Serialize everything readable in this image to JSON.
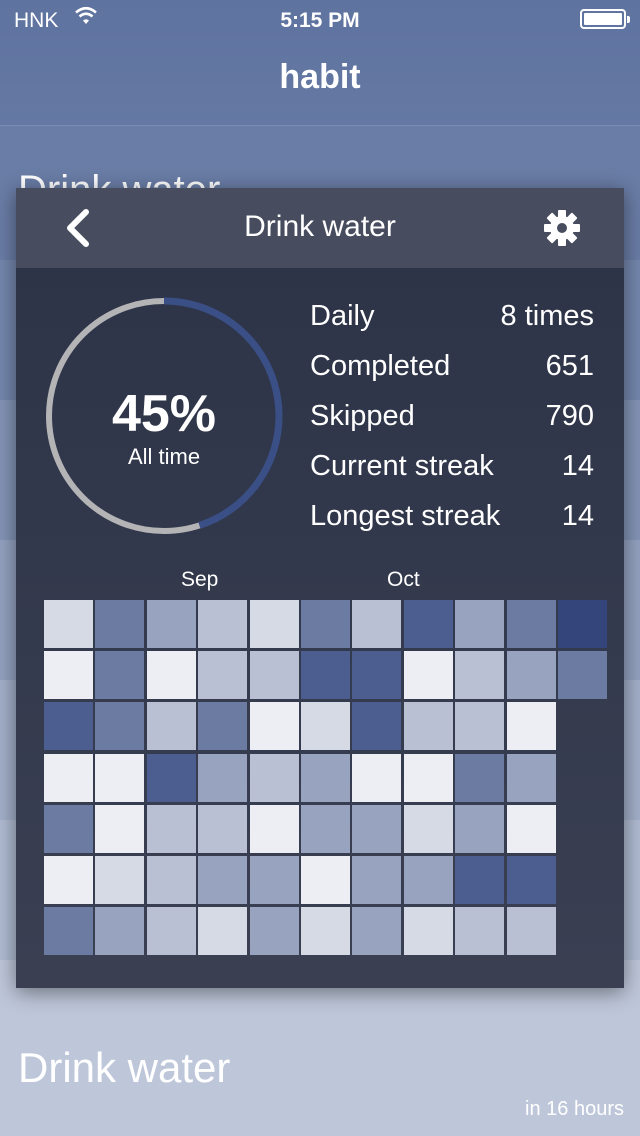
{
  "status_bar": {
    "carrier": "HNK",
    "time": "5:15 PM"
  },
  "app": {
    "title": "habit",
    "background_item_top": "Drink water",
    "background_item_bottom": "Drink water",
    "background_item_bottom_sub": "in 16 hours"
  },
  "card": {
    "title": "Drink water",
    "progress_percent": 45,
    "progress_label": "45%",
    "progress_sub": "All time",
    "stats": [
      {
        "label": "Daily",
        "value": "8 times"
      },
      {
        "label": "Completed",
        "value": "651"
      },
      {
        "label": "Skipped",
        "value": "790"
      },
      {
        "label": "Current streak",
        "value": "14"
      },
      {
        "label": "Longest streak",
        "value": "14"
      }
    ],
    "months": [
      "Sep",
      "Oct"
    ],
    "colors": {
      "accent": "#3b4f87",
      "ring_track": "#b4b4b6",
      "card_bg": "#2d3347",
      "header_bg": "#474d5e"
    },
    "heatmap": {
      "levels": [
        [
          1,
          4,
          3,
          2,
          1,
          4,
          2,
          5,
          3,
          4,
          6
        ],
        [
          0,
          4,
          0,
          2,
          2,
          5,
          5,
          0,
          2,
          3,
          4
        ],
        [
          5,
          4,
          2,
          4,
          0,
          1,
          5,
          2,
          2,
          0,
          null
        ],
        [
          0,
          0,
          5,
          3,
          2,
          3,
          0,
          0,
          4,
          3,
          null
        ],
        [
          4,
          0,
          2,
          2,
          0,
          3,
          3,
          1,
          3,
          0,
          null
        ],
        [
          0,
          1,
          2,
          3,
          3,
          0,
          3,
          3,
          5,
          5,
          null
        ],
        [
          4,
          3,
          2,
          1,
          3,
          1,
          3,
          1,
          2,
          2,
          null
        ]
      ],
      "palette": [
        "#eceef4",
        "#d6dae5",
        "#b9c0d3",
        "#97a3bf",
        "#6b7ba2",
        "#4c5e8f",
        "#34457c"
      ]
    }
  }
}
